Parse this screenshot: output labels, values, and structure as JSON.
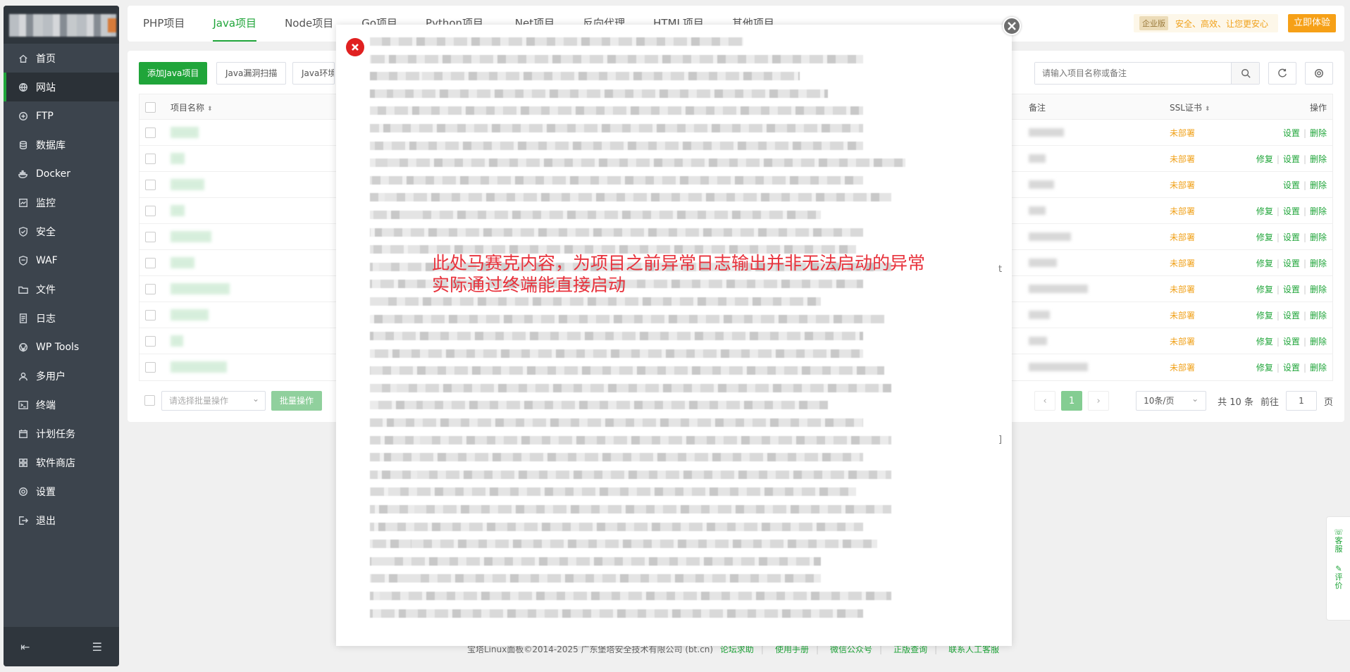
{
  "sidebar": {
    "items": [
      {
        "label": "首页",
        "icon": "home-icon"
      },
      {
        "label": "网站",
        "icon": "globe-icon",
        "active": true
      },
      {
        "label": "FTP",
        "icon": "ftp-icon"
      },
      {
        "label": "数据库",
        "icon": "database-icon"
      },
      {
        "label": "Docker",
        "icon": "docker-icon"
      },
      {
        "label": "监控",
        "icon": "monitor-icon"
      },
      {
        "label": "安全",
        "icon": "shield-icon"
      },
      {
        "label": "WAF",
        "icon": "waf-icon"
      },
      {
        "label": "文件",
        "icon": "folder-icon"
      },
      {
        "label": "日志",
        "icon": "log-icon"
      },
      {
        "label": "WP Tools",
        "icon": "wordpress-icon"
      },
      {
        "label": "多用户",
        "icon": "users-icon"
      },
      {
        "label": "终端",
        "icon": "terminal-icon"
      },
      {
        "label": "计划任务",
        "icon": "calendar-icon"
      },
      {
        "label": "软件商店",
        "icon": "grid-icon"
      },
      {
        "label": "设置",
        "icon": "gear-icon"
      },
      {
        "label": "退出",
        "icon": "logout-icon"
      }
    ]
  },
  "tabs": [
    "PHP项目",
    "Java项目",
    "Node项目",
    "Go项目",
    "Python项目",
    ".Net项目",
    "反向代理",
    "HTML项目",
    "其他项目"
  ],
  "enterprise": {
    "badge": "企业版",
    "slogan": "安全、高效、让您更安心",
    "button": "立即体验"
  },
  "toolbar": {
    "add": "添加Java项目",
    "scan": "Java漏洞扫描",
    "env": "Java环境",
    "search_placeholder": "请输入项目名称或备注"
  },
  "table": {
    "headers": {
      "name": "项目名称",
      "note": "备注",
      "ssl": "SSL证书",
      "ops": "操作"
    },
    "ssl_text": "未部署",
    "op_repair": "修复",
    "op_settings": "设置",
    "op_delete": "删除",
    "rows": [
      {
        "repair": false
      },
      {
        "repair": true
      },
      {
        "repair": false
      },
      {
        "repair": true
      },
      {
        "repair": true
      },
      {
        "repair": true
      },
      {
        "repair": true
      },
      {
        "repair": true
      },
      {
        "repair": true
      },
      {
        "repair": true
      }
    ]
  },
  "footer_controls": {
    "batch_placeholder": "请选择批量操作",
    "batch_button": "批量操作",
    "current_page": "1",
    "page_size": "10条/页",
    "total": "共 10 条",
    "goto_prefix": "前往",
    "goto_value": "1",
    "goto_suffix": "页"
  },
  "page_footer": {
    "copyright": "宝塔Linux面板©2014-2025 广东堡塔安全技术有限公司 (bt.cn)",
    "links": [
      "论坛求助",
      "使用手册",
      "微信公众号",
      "正版查询",
      "联系人工客服"
    ]
  },
  "float_side": {
    "service": "客服",
    "review": "评价"
  },
  "modal": {
    "annotation_line1": "此处马赛克内容，为项目之前异常日志输出并非无法启动的异常",
    "annotation_line2": "实际通过终端能直接启动",
    "stray_t": "t",
    "stray_bracket": "]"
  },
  "colors": {
    "accent": "#20a53a",
    "sidebar": "#3c444d",
    "warning": "#f0a11a",
    "annotation": "#e8323c"
  }
}
